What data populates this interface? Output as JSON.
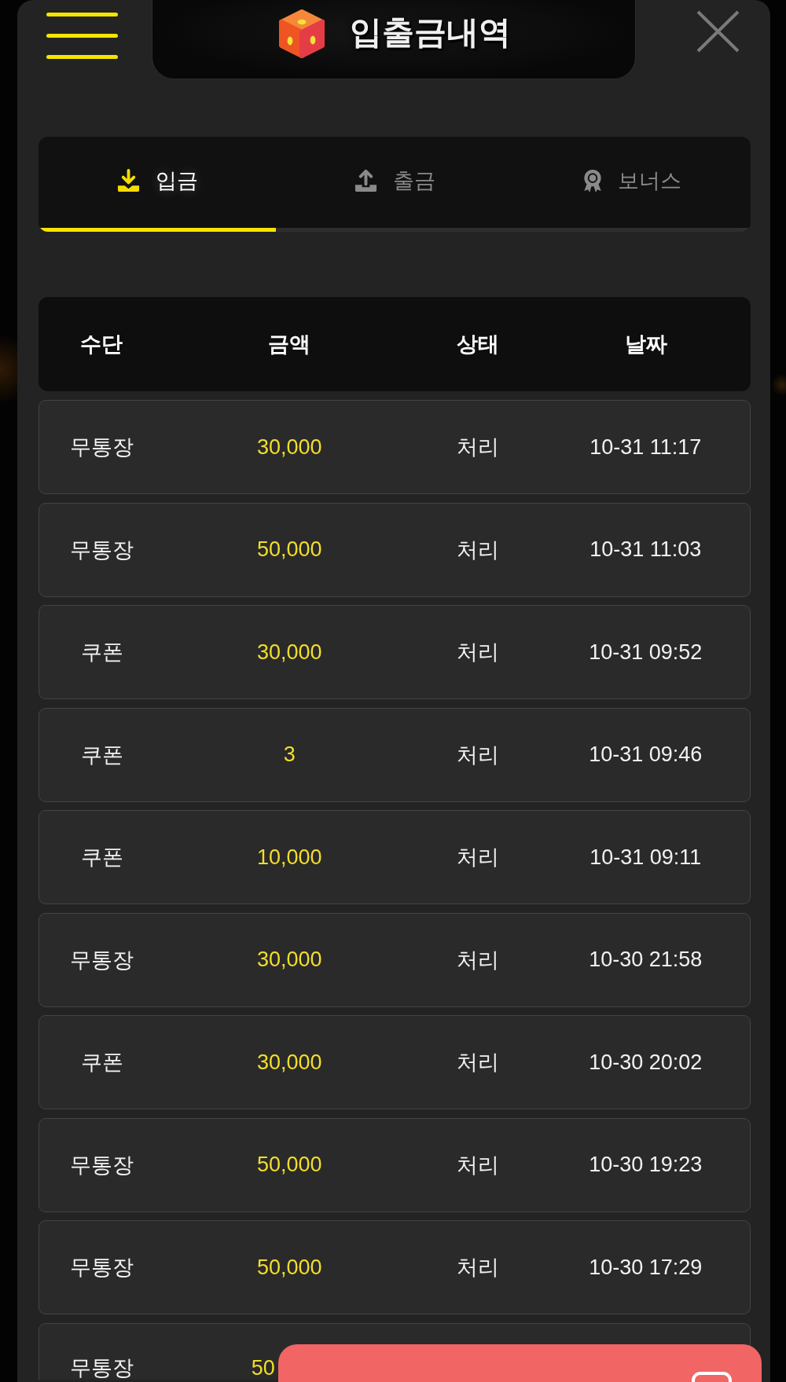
{
  "header": {
    "title": "입출금내역"
  },
  "tabs": [
    {
      "label": "입금",
      "selected": true,
      "kind": "download"
    },
    {
      "label": "출금",
      "selected": false,
      "kind": "upload"
    },
    {
      "label": "보너스",
      "selected": false,
      "kind": "award"
    }
  ],
  "table": {
    "columns": [
      "수단",
      "금액",
      "상태",
      "날짜"
    ],
    "rows": [
      {
        "kind": "full",
        "method": "무통장",
        "amount": "30,000",
        "status": "처리",
        "date": "10-31 11:17"
      },
      {
        "kind": "full",
        "method": "무통장",
        "amount": "50,000",
        "status": "처리",
        "date": "10-31 11:03"
      },
      {
        "kind": "full",
        "method": "쿠폰",
        "amount": "30,000",
        "status": "처리",
        "date": "10-31 09:52"
      },
      {
        "kind": "full",
        "method": "쿠폰",
        "amount": "3",
        "status": "처리",
        "date": "10-31 09:46"
      },
      {
        "kind": "full",
        "method": "쿠폰",
        "amount": "10,000",
        "status": "처리",
        "date": "10-31 09:11"
      },
      {
        "kind": "full",
        "method": "무통장",
        "amount": "30,000",
        "status": "처리",
        "date": "10-30 21:58"
      },
      {
        "kind": "full",
        "method": "쿠폰",
        "amount": "30,000",
        "status": "처리",
        "date": "10-30 20:02"
      },
      {
        "kind": "full",
        "method": "무통장",
        "amount": "50,000",
        "status": "처리",
        "date": "10-30 19:23"
      },
      {
        "kind": "full",
        "method": "무통장",
        "amount": "50,000",
        "status": "처리",
        "date": "10-30 17:29"
      },
      {
        "kind": "partial",
        "method": "무통장",
        "amount": "50"
      }
    ]
  }
}
